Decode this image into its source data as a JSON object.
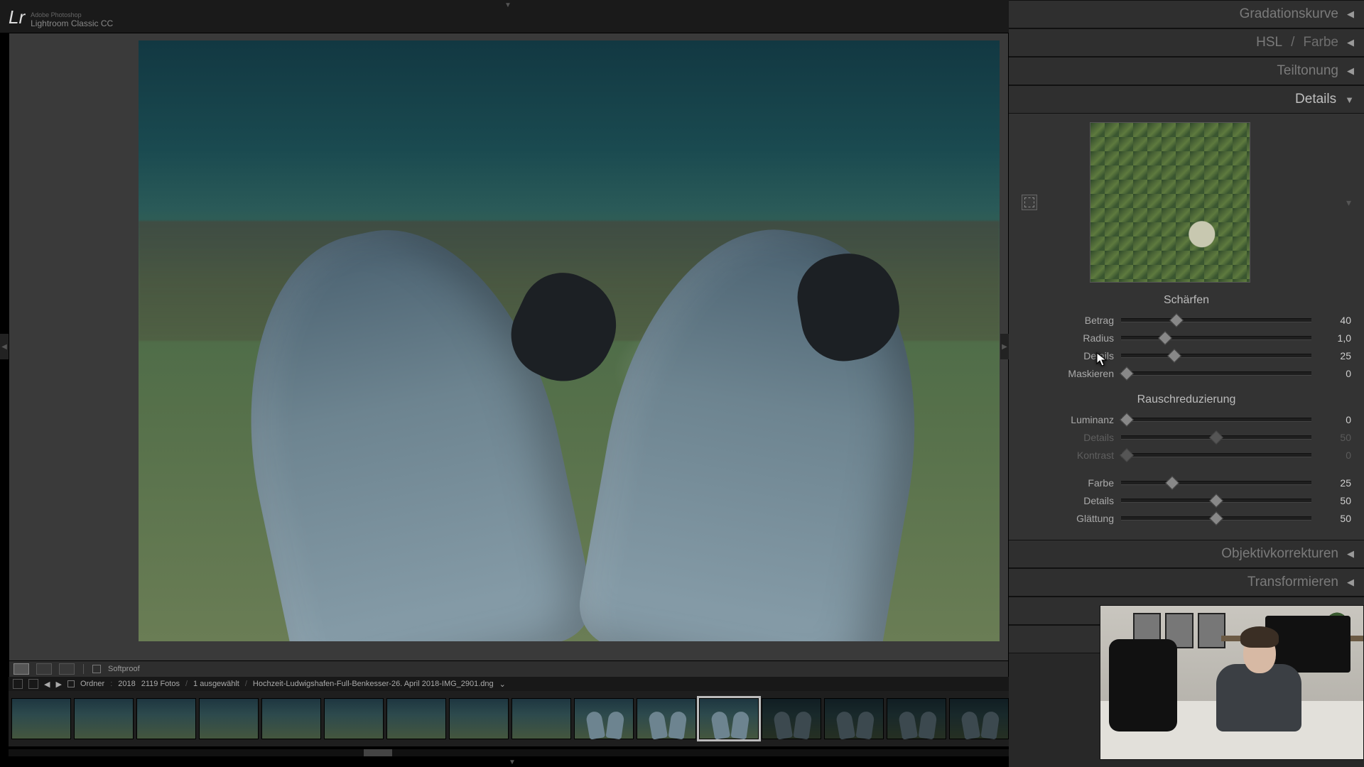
{
  "app": {
    "logo": "Lr",
    "vendor": "Adobe Photoshop",
    "product": "Lightroom Classic CC"
  },
  "toolbar": {
    "softproof_label": "Softproof"
  },
  "breadcrumb": {
    "folder_label": "Ordner",
    "year": "2018",
    "count_label": "2119 Fotos",
    "selected_label": "1 ausgewählt",
    "filename": "Hochzeit-Ludwigshafen-Full-Benkesser-26. April 2018-IMG_2901.dng"
  },
  "filmstrip": {
    "selected_index": 11,
    "total": 16
  },
  "panels": {
    "tone_curve": "Gradationskurve",
    "hsl_a": "HSL",
    "hsl_b": "Farbe",
    "split": "Teiltonung",
    "details": "Details",
    "lens": "Objektivkorrekturen",
    "transform": "Transformieren"
  },
  "details": {
    "sharpen_title": "Schärfen",
    "sharpen": {
      "amount": {
        "label": "Betrag",
        "value": "40",
        "pct": 29
      },
      "radius": {
        "label": "Radius",
        "value": "1,0",
        "pct": 23
      },
      "detail": {
        "label": "Details",
        "value": "25",
        "pct": 28
      },
      "mask": {
        "label": "Maskieren",
        "value": "0",
        "pct": 3
      }
    },
    "nr_title": "Rauschreduzierung",
    "nr": {
      "luminance": {
        "label": "Luminanz",
        "value": "0",
        "pct": 3
      },
      "detail": {
        "label": "Details",
        "value": "50",
        "pct": 50
      },
      "contrast": {
        "label": "Kontrast",
        "value": "0",
        "pct": 3
      },
      "color": {
        "label": "Farbe",
        "value": "25",
        "pct": 27
      },
      "cdetail": {
        "label": "Details",
        "value": "50",
        "pct": 50
      },
      "smooth": {
        "label": "Glättung",
        "value": "50",
        "pct": 50
      }
    }
  }
}
